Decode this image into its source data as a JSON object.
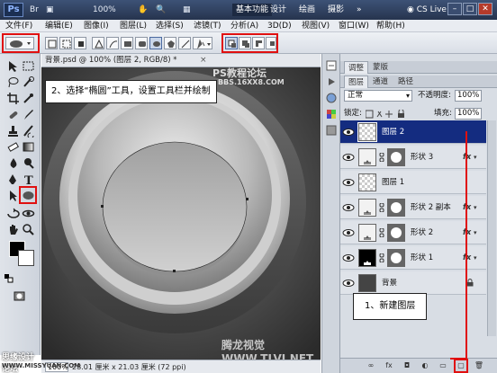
{
  "app": {
    "logo": "Ps",
    "zoom_menu": "100%",
    "workspaces": [
      "基本功能",
      "设计",
      "绘画",
      "摄影"
    ],
    "cs_live": "CS Live",
    "window_buttons": [
      "–",
      "□",
      "✕"
    ]
  },
  "menu": [
    "文件(F)",
    "编辑(E)",
    "图像(I)",
    "图层(L)",
    "选择(S)",
    "滤镜(T)",
    "分析(A)",
    "3D(D)",
    "视图(V)",
    "窗口(W)",
    "帮助(H)"
  ],
  "document": {
    "tab_label": "背景.psd @ 100% (图层 2, RGB/8) *",
    "close": "×",
    "zoom": "100%",
    "doc_info": "28.01 厘米 x 21.03 厘米 (72 ppi)"
  },
  "annotations": {
    "step2": "2、选择“椭圆”工具，设置工具栏并绘制",
    "step1": "1、新建图层"
  },
  "layers_panel": {
    "top_tabs": [
      "调整",
      "蒙版"
    ],
    "tabs": [
      "图层",
      "通道",
      "路径"
    ],
    "blend_mode": "正常",
    "opacity_label": "不透明度:",
    "opacity_value": "100%",
    "lock_label": "锁定:",
    "fill_label": "填充:",
    "fill_value": "100%",
    "layers": [
      {
        "name": "图层 2",
        "selected": true,
        "fx": false,
        "mask": false,
        "thumb": "checker"
      },
      {
        "name": "形状 3",
        "selected": false,
        "fx": true,
        "mask": true,
        "thumb": "shape-light"
      },
      {
        "name": "图层 1",
        "selected": false,
        "fx": false,
        "mask": false,
        "thumb": "checker"
      },
      {
        "name": "形状 2 副本",
        "selected": false,
        "fx": true,
        "mask": true,
        "thumb": "shape-light"
      },
      {
        "name": "形状 2",
        "selected": false,
        "fx": true,
        "mask": true,
        "thumb": "shape-light"
      },
      {
        "name": "形状 1",
        "selected": false,
        "fx": true,
        "mask": true,
        "thumb": "shape-dark"
      },
      {
        "name": "背景",
        "selected": false,
        "fx": false,
        "mask": false,
        "thumb": "dark",
        "locked": true
      }
    ],
    "fx_label": "fx"
  },
  "watermarks": {
    "top": "PS教程论坛",
    "top2": "BBS.16XX8.COM",
    "bottom_left": "思缘设计论坛",
    "bottom_left2": "WWW.MISSYUAN.COM",
    "bottom_right": "腾龙视觉 WWW.TLVI.NET"
  },
  "colors": {
    "selection": "#142c80",
    "annotation_red": "#e01010",
    "title_bar": "#2e3f5f"
  }
}
